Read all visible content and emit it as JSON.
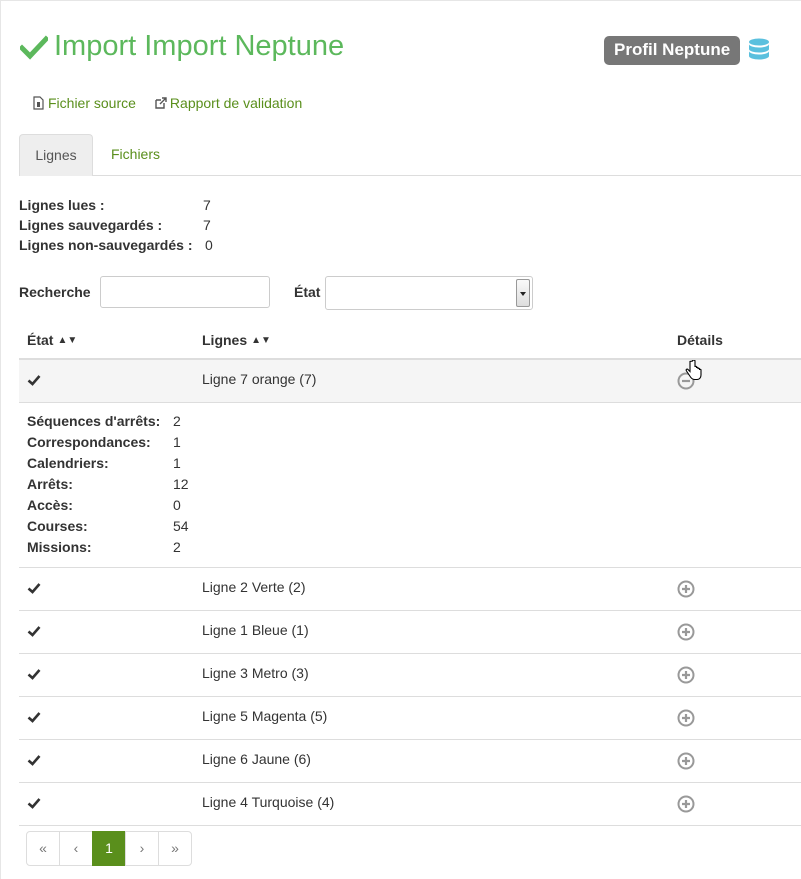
{
  "colors": {
    "accent": "#5a8f1c",
    "success": "#5cb85c",
    "badge": "#777777",
    "db_icon": "#5bc0de"
  },
  "header": {
    "title": "Import Import Neptune",
    "profile_badge": "Profil Neptune"
  },
  "links": {
    "source": "Fichier source",
    "report": "Rapport de validation"
  },
  "tabs": [
    {
      "label": "Lignes"
    },
    {
      "label": "Fichiers"
    }
  ],
  "stats": [
    {
      "label": "Lignes lues :",
      "value": "7"
    },
    {
      "label": "Lignes sauvegardés :",
      "value": "7"
    },
    {
      "label": "Lignes non-sauvegardés :",
      "value": "0"
    }
  ],
  "filters": {
    "search_label": "Recherche",
    "search_value": "",
    "state_label": "État",
    "state_value": ""
  },
  "table": {
    "headers": {
      "state": "État",
      "lines": "Lignes",
      "details": "Détails"
    },
    "rows": [
      {
        "name": "Ligne 7 orange (7)",
        "expanded": true
      },
      {
        "name": "Ligne 2 Verte (2)",
        "expanded": false
      },
      {
        "name": "Ligne 1 Bleue (1)",
        "expanded": false
      },
      {
        "name": "Ligne 3 Metro (3)",
        "expanded": false
      },
      {
        "name": "Ligne 5 Magenta (5)",
        "expanded": false
      },
      {
        "name": "Ligne 6 Jaune (6)",
        "expanded": false
      },
      {
        "name": "Ligne 4 Turquoise (4)",
        "expanded": false
      }
    ],
    "details": [
      {
        "label": "Séquences d'arrêts:",
        "value": "2"
      },
      {
        "label": "Correspondances:",
        "value": "1"
      },
      {
        "label": "Calendriers:",
        "value": "1"
      },
      {
        "label": "Arrêts:",
        "value": "12"
      },
      {
        "label": "Accès:",
        "value": "0"
      },
      {
        "label": "Courses:",
        "value": "54"
      },
      {
        "label": "Missions:",
        "value": "2"
      }
    ]
  },
  "pagination": {
    "first": "«",
    "prev": "‹",
    "current": "1",
    "next": "›",
    "last": "»"
  }
}
